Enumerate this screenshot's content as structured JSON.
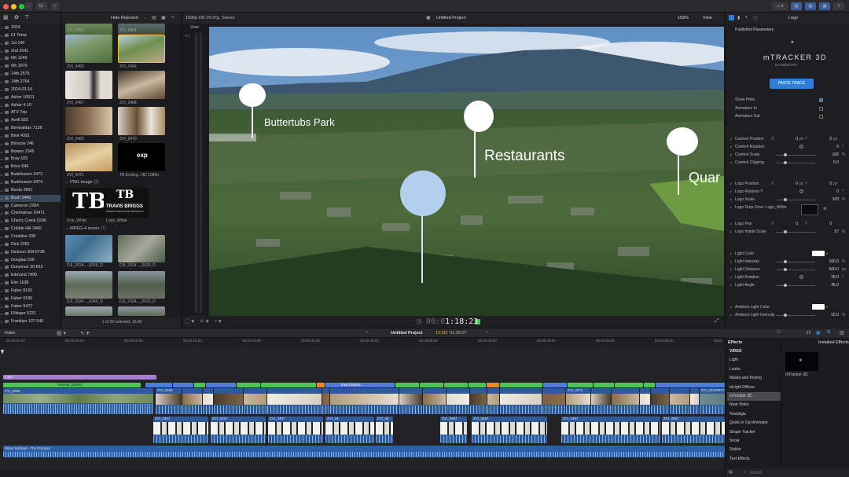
{
  "toolbar": {
    "keywords_btn": "O⌐",
    "layout_icons": [
      "film-icon",
      "layout-icon"
    ]
  },
  "library": {
    "items": [
      "2024",
      "01 Temp",
      "1st 140",
      "2nd 2641",
      "6th 1049",
      "6th 2979",
      "14th 2575",
      "14th 2764",
      "2024-03-10",
      "Asher 10511",
      "Ashar 4-10",
      "ATV Trip",
      "Avrill 932",
      "Benwaldun 7128",
      "Best 4391",
      "Binnicle 246",
      "Bowen 2345",
      "Bray 105",
      "Brice 646",
      "Budehaven 3473",
      "Budehaven 3474",
      "Burda 2891",
      "Bush 1440",
      "Cameron 2284",
      "Chemainus 10471",
      "Cherry Creek 5296",
      "Cobble Hill 3460",
      "Crestline 208",
      "Dick 2252",
      "Dickson 308-6738",
      "Douglas 530",
      "Dunsmuir 30-815",
      "Edmund 7990",
      "Elm 1638",
      "Faber 8165",
      "Faber 9195",
      "Faber 9472",
      "Fillinger 5231",
      "Franklyn 107-540"
    ],
    "selected": "Bush 1440"
  },
  "browser": {
    "filter": "Hide Rejected",
    "clips_top": [
      {
        "label": "ZVI_6090"
      },
      {
        "label": "ZVI_3464"
      },
      {
        "label": "ZVI_3465"
      },
      {
        "label": "ZVI_3466"
      },
      {
        "label": "ZVI_3467"
      },
      {
        "label": "ZVI_3468"
      },
      {
        "label": "ZVI_3469"
      },
      {
        "label": "ZVI_3470"
      },
      {
        "label": "ZVI_3471"
      },
      {
        "label": "TB Ending...HD 1080p"
      }
    ],
    "png_section": "PNG image",
    "png_count": "(2)",
    "png_items": [
      {
        "label": "Icon_White"
      },
      {
        "label": "Logo_White"
      }
    ],
    "logo_name": "TRAVIS BRIGGS",
    "logo_sub": "PERSONAL REAL ESTATE CORPORATION",
    "exp_logo": "exp",
    "mpeg_section": "MPEG-4 movie",
    "mpeg_count": "(7)",
    "mpeg_items": [
      {
        "label": "DJI_2024..._0030_D"
      },
      {
        "label": "DJI_2024..._0020_D"
      },
      {
        "label": "DJI_2024..._0340_D"
      },
      {
        "label": "DJI_2024..._0010_D"
      }
    ],
    "footer": "1 of 23 selected, 15;06"
  },
  "viewer": {
    "format": "1080p HD 29.97p, Stereo",
    "project_title": "Untitled Project",
    "zoom": "158%",
    "view_label": "View",
    "meter_label": "View",
    "meter_db": "RG",
    "timecode": "00:01:18:23",
    "timecode_dim": "00:0",
    "timecode_bright": "1:18:23",
    "pins": [
      {
        "label": "Buttertubs Park"
      },
      {
        "label": "Restaurants"
      },
      {
        "label": "Quar"
      }
    ]
  },
  "inspector": {
    "title": "Logo",
    "section": "Published Parameters",
    "plugin_name": "mTRACKER 3D",
    "plugin_by": "by MotionVFX",
    "paste_button": "PASTE TRACK",
    "checks": [
      {
        "label": "Show Hints",
        "checked": true
      },
      {
        "label": "Animation In",
        "checked": false
      },
      {
        "label": "Animation Out",
        "checked": false
      }
    ],
    "params": [
      {
        "label": "Content Position",
        "x": "0",
        "y": "0",
        "unit": "px",
        "type": "xy"
      },
      {
        "label": "Content Rotation",
        "value": "0",
        "unit": "°",
        "type": "dial"
      },
      {
        "label": "Content Scale",
        "value": "182",
        "unit": "%",
        "type": "slider"
      },
      {
        "label": "Content Clipping",
        "value": "5.0",
        "unit": "",
        "type": "slider"
      },
      {
        "label": "Logo Position",
        "x": "0",
        "y": "0",
        "unit": "px",
        "type": "xy"
      },
      {
        "label": "Logo Rotation Y",
        "value": "0",
        "unit": "°",
        "type": "dial"
      },
      {
        "label": "Logo Scale",
        "value": "100",
        "unit": "%",
        "type": "slider"
      },
      {
        "label": "Logo Drop Zone: Logo_White",
        "value": "",
        "unit": "",
        "type": "drop"
      },
      {
        "label": "Logo Pan",
        "x": "0",
        "y": "0",
        "unit": "",
        "type": "xy"
      },
      {
        "label": "Logo Inside Scale",
        "value": "57",
        "unit": "%",
        "type": "slider"
      },
      {
        "label": "Light Color",
        "value": "",
        "unit": "",
        "type": "color"
      },
      {
        "label": "Light Intensity",
        "value": "150.0",
        "unit": "%",
        "type": "slider"
      },
      {
        "label": "Light Distance",
        "value": "600.0",
        "unit": "px",
        "type": "slider"
      },
      {
        "label": "Light Rotation",
        "value": "26.0",
        "unit": "°",
        "type": "dial"
      },
      {
        "label": "Light Angle",
        "value": "45.0",
        "unit": "",
        "type": "slider"
      },
      {
        "label": "Ambient Light Color",
        "value": "",
        "unit": "",
        "type": "color"
      },
      {
        "label": "Ambient Light Intensity",
        "value": "15.0",
        "unit": "%",
        "type": "slider"
      }
    ]
  },
  "timeline": {
    "index_label": "Index",
    "project": "Untitled Project",
    "position": "12:28",
    "duration": "01:39:27",
    "ruler": [
      "00:00:00:00",
      "00:00:05:00",
      "00:00:10:00",
      "00:00:15:00",
      "00:00:20:00",
      "00:00:25:00",
      "00:00:30:00",
      "00:00:35:00",
      "00:00:40:00",
      "00:00:45:00",
      "00:00:50:00",
      "00:00:55:00",
      "00:01"
    ],
    "title_clip": "Logo",
    "speed_normal": "Normal (100%)",
    "speed_fast": "Fast (345%)",
    "primary_first": "ZVI_3465",
    "primary_second": "ZVI_3469",
    "primary_third": "ZVI_3471",
    "primary_last": "DJI_20240917142032_0921...",
    "connected": [
      "ZVI_3467",
      "ZVI_3467",
      "ZVI_3467",
      "ZVI_34",
      "ZVI_34",
      "ZVI_3467",
      "ZVI_3467",
      "ZVI_3467",
      "ZVI_3467"
    ],
    "audio": "Oliver Michael - The Promise"
  },
  "effects": {
    "title": "Effects",
    "installed": "Installed Effects",
    "categories": [
      "VIDEO",
      "Light",
      "Looks",
      "Masks and Keying",
      "mLight Diffuse",
      "mTracker 3D",
      "Neat Video",
      "Nostalgia",
      "Quick In Out Animator",
      "Shape Tracker",
      "Snow",
      "Stylize",
      "Text Effects"
    ],
    "selected": "mTracker 3D",
    "installed_item": "mTracker 3D",
    "search_placeholder": "Search"
  },
  "colors": {
    "accent": "#2f7fd6",
    "primary_clip": "#2f5a9a",
    "audio_clip": "#2c5fa8",
    "title_clip": "#a97bd3",
    "speed_green": "#4fc25a",
    "speed_blue": "#4b7fd4"
  }
}
